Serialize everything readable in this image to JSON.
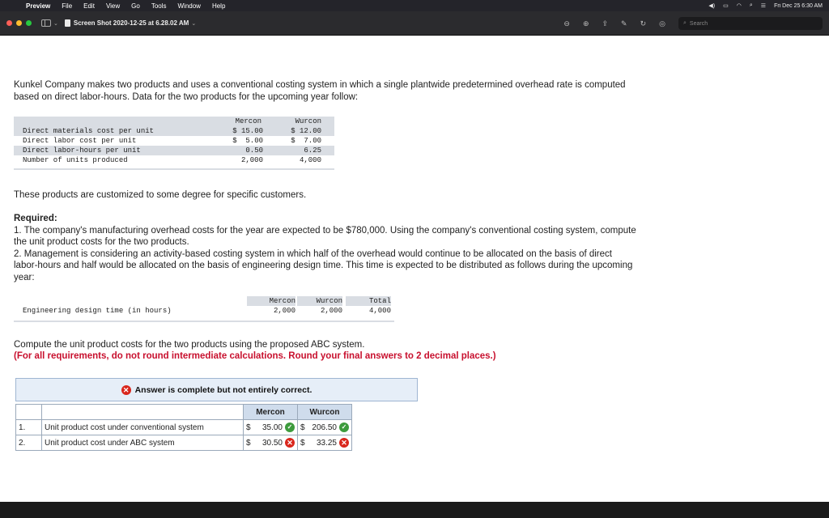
{
  "menubar": {
    "apple_glyph": "",
    "app_name": "Preview",
    "items": [
      "File",
      "Edit",
      "View",
      "Go",
      "Tools",
      "Window",
      "Help"
    ],
    "clock": "Fri Dec 25  6:30 AM"
  },
  "toolbar": {
    "document_title": "Screen Shot 2020-12-25 at 6.28.02 AM",
    "search_placeholder": "Search"
  },
  "intro": "Kunkel Company makes two products and uses a conventional costing system in which a single plantwide predetermined overhead rate is computed based on direct labor-hours. Data for the two products for the upcoming year follow:",
  "product_table": {
    "headers": [
      "Mercon",
      "Wurcon"
    ],
    "rows": [
      {
        "label": "Direct materials cost per unit",
        "mercon": "$ 15.00",
        "wurcon": "$ 12.00"
      },
      {
        "label": "Direct labor cost per unit",
        "mercon": "$  5.00",
        "wurcon": "$  7.00"
      },
      {
        "label": "Direct labor-hours per unit",
        "mercon": "0.50",
        "wurcon": "6.25"
      },
      {
        "label": "Number of units produced",
        "mercon": "2,000",
        "wurcon": "4,000"
      }
    ]
  },
  "customized_text": "These products are customized to some degree for specific customers.",
  "required": {
    "heading": "Required:",
    "item1": "1. The company's manufacturing overhead costs for the year are expected to be $780,000. Using the company's conventional costing system, compute the unit product costs for the two products.",
    "item2": "2. Management is considering an activity-based costing system in which half of the overhead would continue to be allocated on the basis of direct labor-hours and half would be allocated on the basis of engineering design time. This time is expected to be distributed as follows during the upcoming year:"
  },
  "engineering_table": {
    "headers": [
      "Mercon",
      "Wurcon",
      "Total"
    ],
    "label": "Engineering design time (in hours)",
    "values": [
      "2,000",
      "2,000",
      "4,000"
    ]
  },
  "compute_text": "Compute the unit product costs for the two products using the proposed ABC system.",
  "note_text": "(For all requirements, do not round intermediate calculations. Round your final answers to 2 decimal places.)",
  "answer_banner": "Answer is complete but not entirely correct.",
  "answer_table": {
    "headers": [
      "Mercon",
      "Wurcon"
    ],
    "rows": [
      {
        "num": "1.",
        "label": "Unit product cost under conventional system",
        "mercon": "35.00",
        "mercon_status": "correct",
        "wurcon": "206.50",
        "wurcon_status": "correct"
      },
      {
        "num": "2.",
        "label": "Unit product cost under ABC system",
        "mercon": "30.50",
        "mercon_status": "incorrect",
        "wurcon": "33.25",
        "wurcon_status": "incorrect"
      }
    ],
    "currency": "$"
  },
  "colors": {
    "correct": "#3d9b3d",
    "incorrect": "#d9261c",
    "note": "#c8102e",
    "header_fill": "#cfdcec"
  }
}
